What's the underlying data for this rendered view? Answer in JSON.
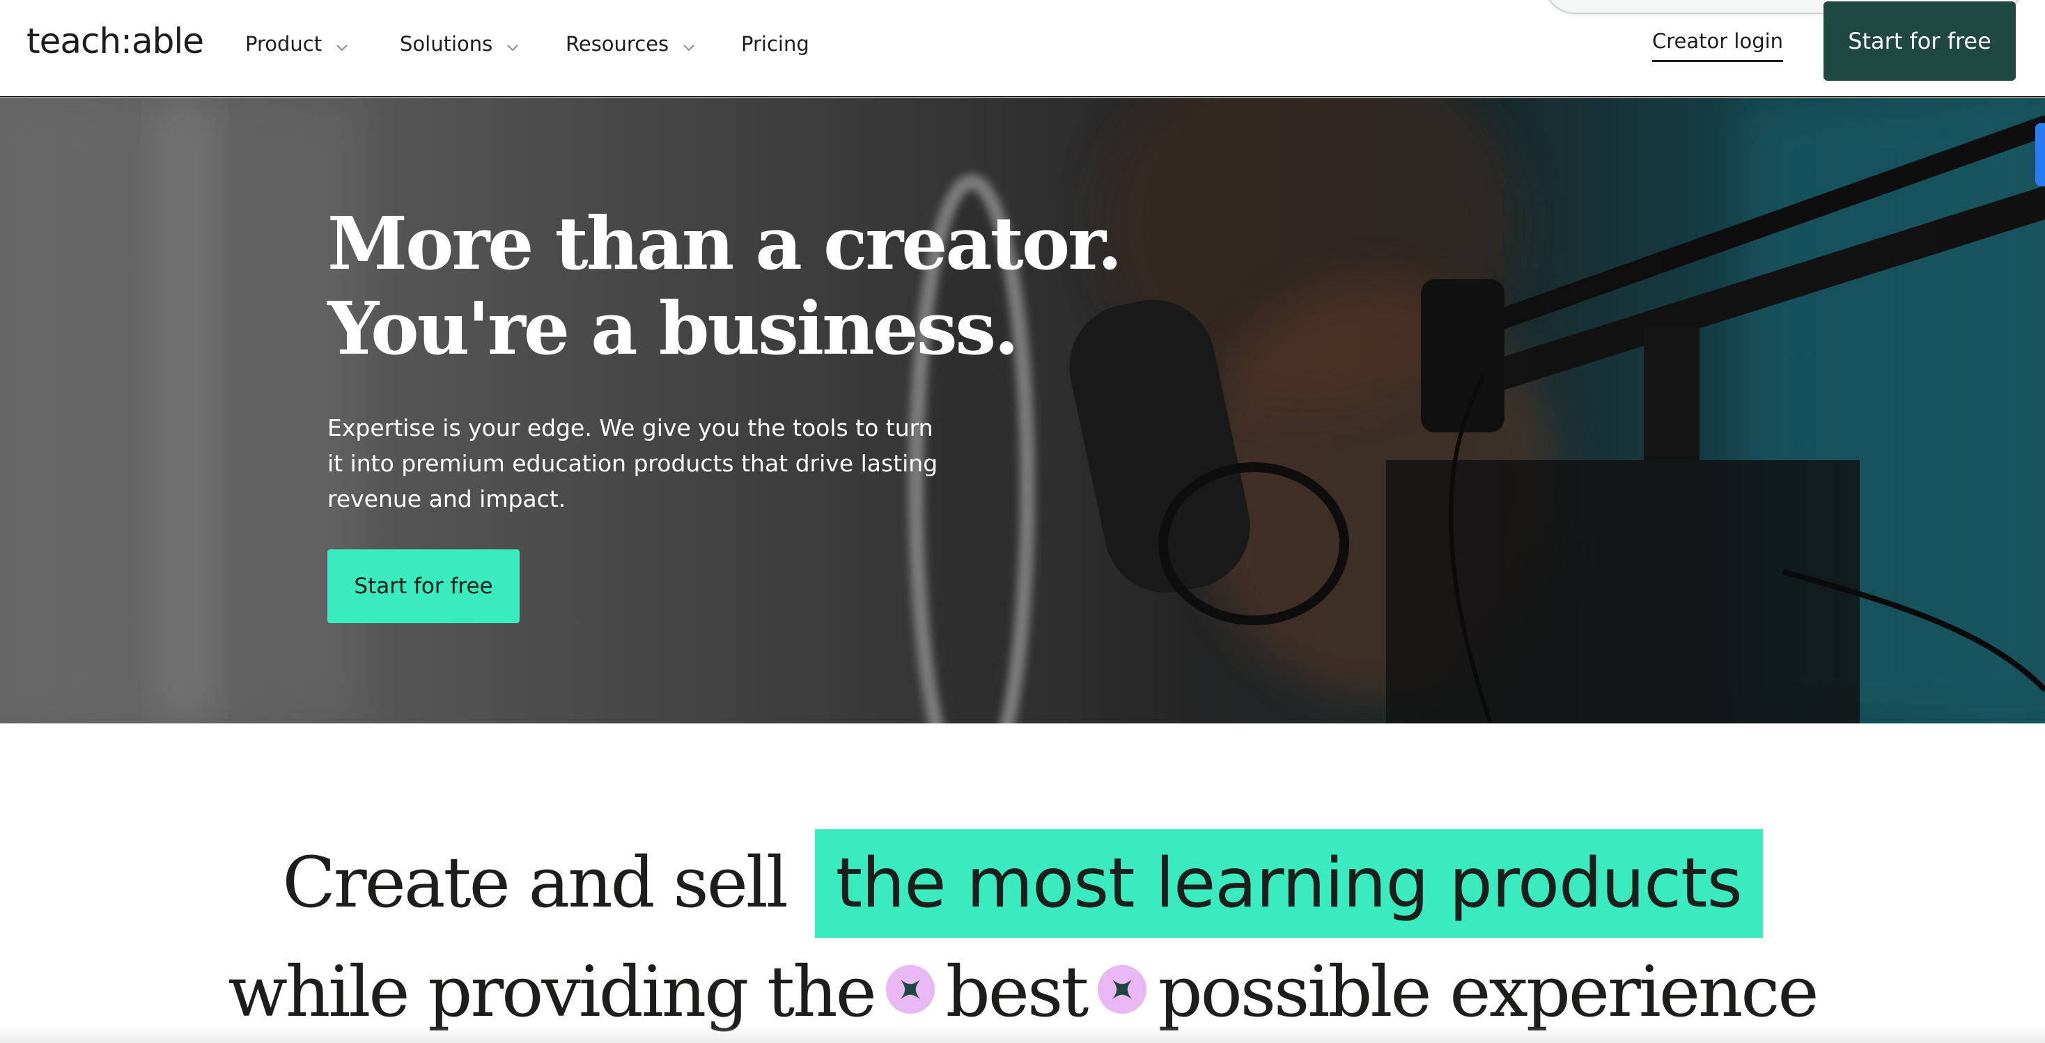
{
  "nav": {
    "logo": "teach:able",
    "items": [
      {
        "label": "Product",
        "has_dropdown": true,
        "icon": "chevron-down-icon"
      },
      {
        "label": "Solutions",
        "has_dropdown": true,
        "icon": "chevron-down-icon"
      },
      {
        "label": "Resources",
        "has_dropdown": true,
        "icon": "chevron-down-icon"
      },
      {
        "label": "Pricing",
        "has_dropdown": false
      }
    ],
    "login_label": "Creator login",
    "cta_label": "Start for free"
  },
  "hero": {
    "title_line1": "More than a creator.",
    "title_line2": "You're a business.",
    "subtitle": "Expertise is your edge. We give you the tools to turn it into premium education products that drive lasting revenue and impact.",
    "cta_label": "Start for free"
  },
  "section": {
    "line1_prefix": "Create and sell",
    "line1_highlight": "the most learning products",
    "line2_part1": "while providing the",
    "line2_part2": "best",
    "line2_part3": "possible experience",
    "sparkle_icon": "sparkle-icon"
  },
  "colors": {
    "brand_dark": "#1e4841",
    "accent_mint": "#3aebbd",
    "sparkle_pink": "#e9b7f3",
    "text": "#1d1d1b"
  }
}
